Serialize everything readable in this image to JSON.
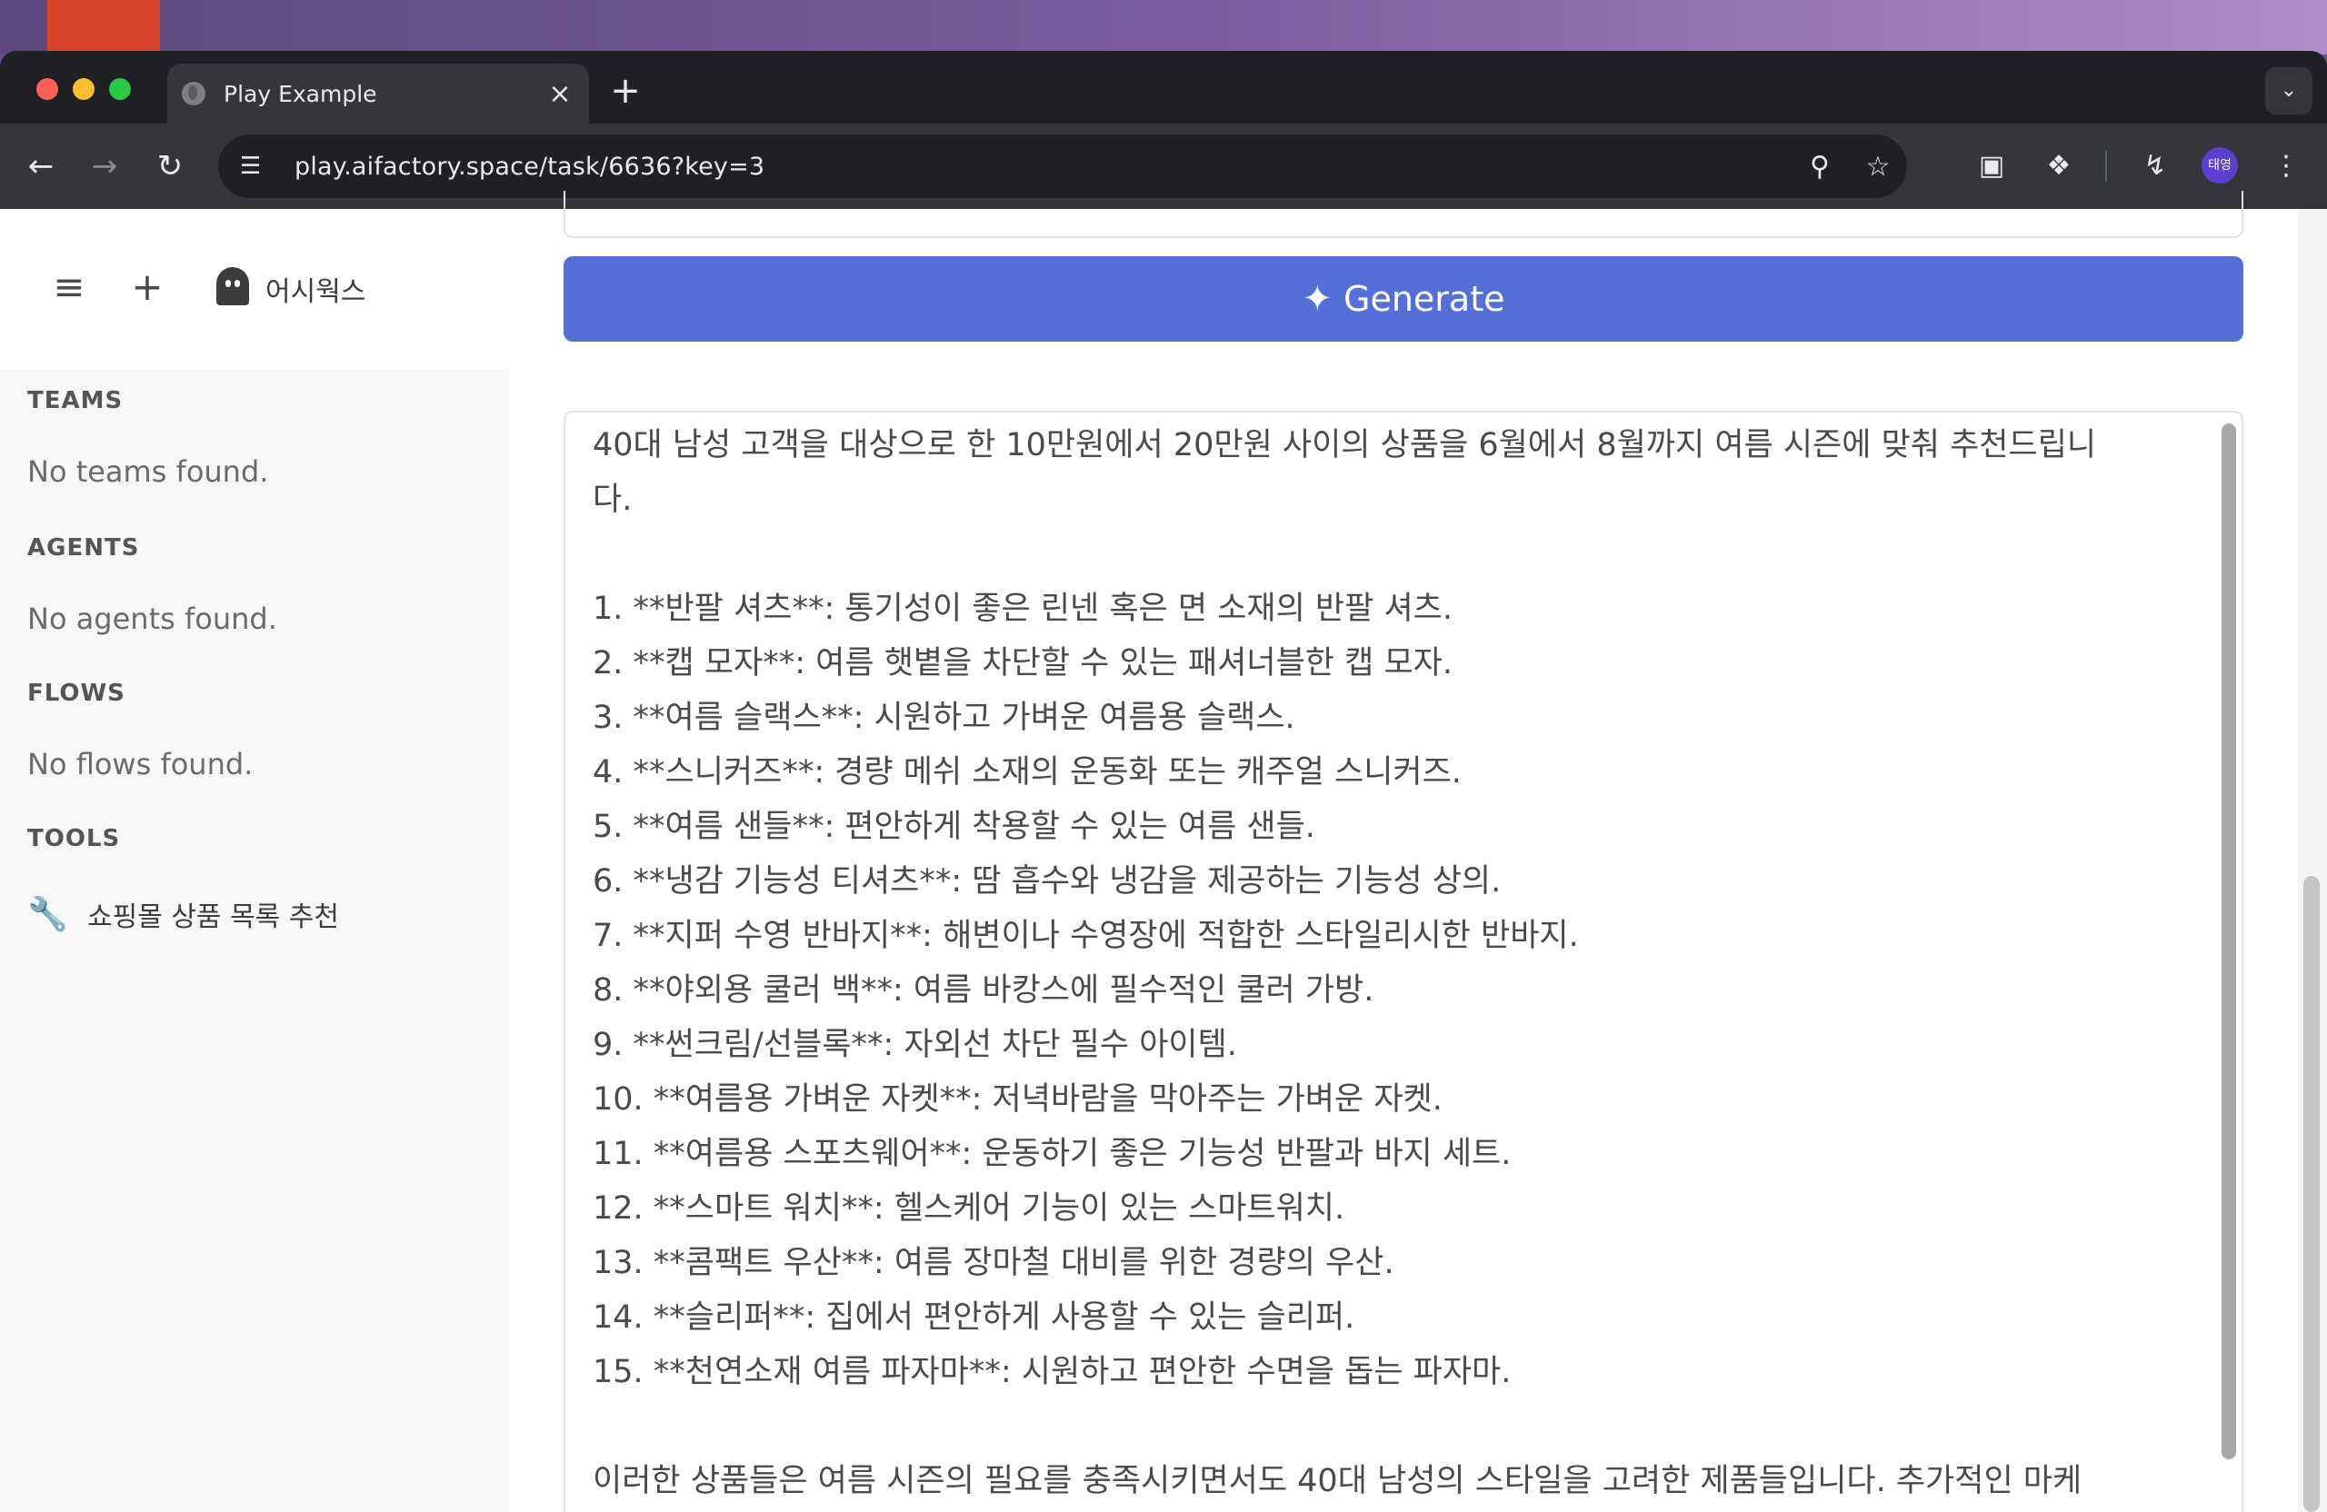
{
  "browser": {
    "tab_title": "Play Example",
    "tab_close": "×",
    "new_tab": "+",
    "url": "play.aifactory.space/task/6636?key=3",
    "profile_initials": "태영"
  },
  "sidebar": {
    "workspace": "어시웍스",
    "sections": [
      {
        "title": "TEAMS",
        "empty": "No teams found."
      },
      {
        "title": "AGENTS",
        "empty": "No agents found."
      },
      {
        "title": "FLOWS",
        "empty": "No flows found."
      },
      {
        "title": "TOOLS"
      }
    ],
    "tools": [
      {
        "label": "쇼핑몰 상품 목록 추천",
        "icon": "wrench-icon"
      }
    ]
  },
  "main": {
    "generate_label": "Generate",
    "output": "40대 남성 고객을 대상으로 한 10만원에서 20만원 사이의 상품을 6월에서 8월까지 여름 시즌에 맞춰 추천드립니\n다.\n\n1. **반팔 셔츠**: 통기성이 좋은 린넨 혹은 면 소재의 반팔 셔츠.\n2. **캡 모자**: 여름 햇볕을 차단할 수 있는 패셔너블한 캡 모자.\n3. **여름 슬랙스**: 시원하고 가벼운 여름용 슬랙스.\n4. **스니커즈**: 경량 메쉬 소재의 운동화 또는 캐주얼 스니커즈.\n5. **여름 샌들**: 편안하게 착용할 수 있는 여름 샌들.\n6. **냉감 기능성 티셔츠**: 땀 흡수와 냉감을 제공하는 기능성 상의.\n7. **지퍼 수영 반바지**: 해변이나 수영장에 적합한 스타일리시한 반바지.\n8. **야외용 쿨러 백**: 여름 바캉스에 필수적인 쿨러 가방.\n9. **썬크림/선블록**: 자외선 차단 필수 아이템.\n10. **여름용 가벼운 자켓**: 저녁바람을 막아주는 가벼운 자켓.\n11. **여름용 스포츠웨어**: 운동하기 좋은 기능성 반팔과 바지 세트.\n12. **스마트 워치**: 헬스케어 기능이 있는 스마트워치.\n13. **콤팩트 우산**: 여름 장마철 대비를 위한 경량의 우산.\n14. **슬리퍼**: 집에서 편안하게 사용할 수 있는 슬리퍼.\n15. **천연소재 여름 파자마**: 시원하고 편안한 수면을 돕는 파자마.\n\n이러한 상품들은 여름 시즌의 필요를 충족시키면서도 40대 남성의 스타일을 고려한 제품들입니다. 추가적인 마케\n팅 팁으로는, 개별 제품에 맞는 스타일링 팁이나 사용 장면을 제안하는 내용을 포함해 고객의 구매욕구를 높일 수"
  },
  "colors": {
    "accent": "#5470d8",
    "browser_dark": "#202124",
    "browser_toolbar": "#35363a"
  }
}
